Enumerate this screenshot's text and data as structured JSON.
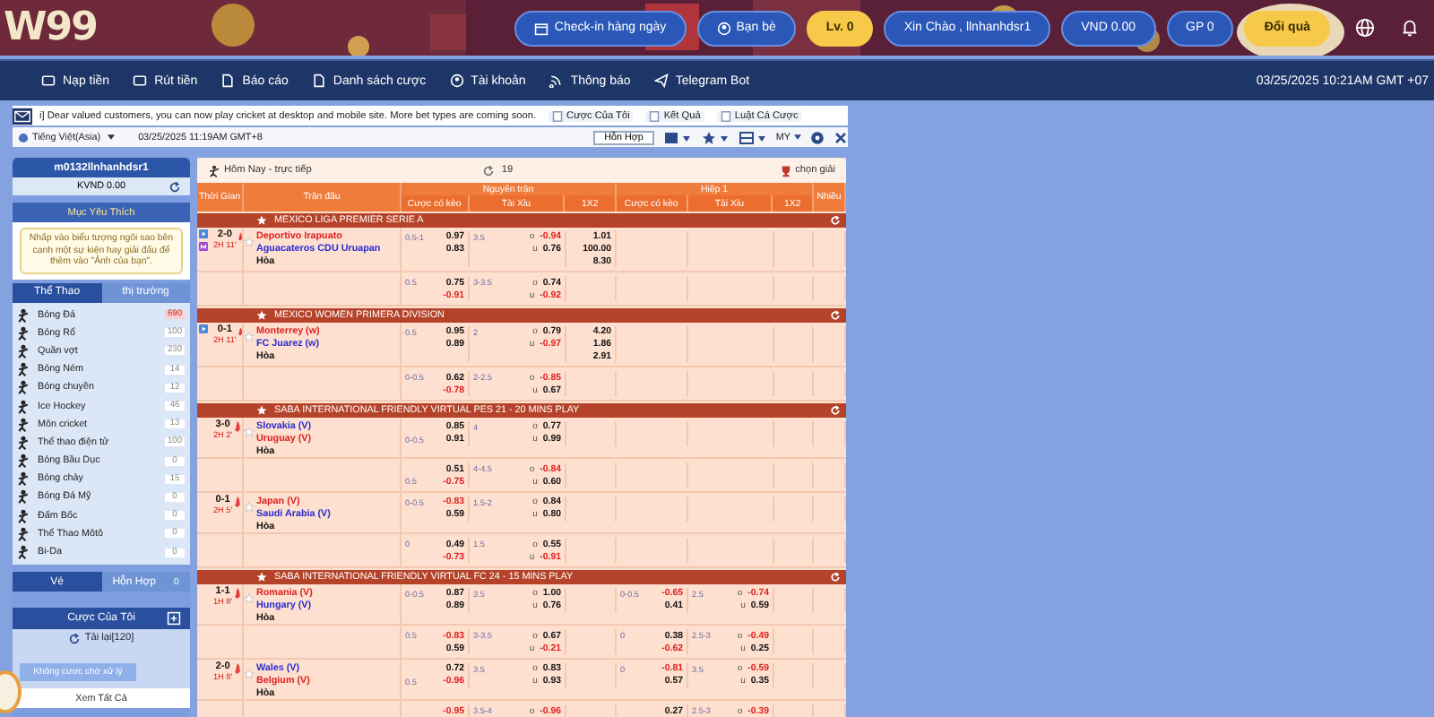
{
  "header": {
    "logo": "W99",
    "buttons": [
      {
        "label": "Check-in hàng ngày",
        "kind": "blue"
      },
      {
        "label": "Bạn bè",
        "kind": "blue"
      },
      {
        "label": "Lv. 0",
        "kind": "gold"
      },
      {
        "label": "Xin Chào , llnhanhdsr1",
        "kind": "blue"
      },
      {
        "label": "VND 0.00",
        "kind": "blue"
      },
      {
        "label": "GP 0",
        "kind": "blue"
      },
      {
        "label": "Đổi quà",
        "kind": "gold"
      }
    ]
  },
  "nav": {
    "items": [
      "Nạp tiền",
      "Rút tiền",
      "Báo cáo",
      "Danh sách cược",
      "Tài khoản",
      "Thông báo",
      "Telegram Bot"
    ],
    "datetime": "03/25/2025 10:21AM GMT +07"
  },
  "ticker": {
    "message": "i] Dear valued customers, you can now play cricket at desktop and mobile site. More bet types are coming soon.",
    "links": [
      "Cược Của Tôi",
      "Kết Quả",
      "Luật Cá Cược"
    ]
  },
  "toolbar": {
    "language": "Tiếng Việt(Asia)",
    "datetime": "03/25/2025 11:19AM GMT+8",
    "mode_button": "Hỗn Hợp",
    "odds_type": "MY"
  },
  "sidebar": {
    "username": "m0132llnhanhdsr1",
    "balance": "KVND 0.00",
    "favorites_title": "Mục Yêu Thích",
    "favorites_hint": "Nhấp vào biểu tượng ngôi sao bên cạnh một sự kiện hay giải đấu để thêm vào \"Ảnh của bạn\".",
    "tabs": [
      {
        "label": "Thể Thao",
        "selected": true
      },
      {
        "label": "thị trường",
        "selected": false
      }
    ],
    "sports": [
      {
        "name": "Bóng Đá",
        "count": "690",
        "hot": true
      },
      {
        "name": "Bóng Rổ",
        "count": "100",
        "hot": false
      },
      {
        "name": "Quần vợt",
        "count": "230",
        "hot": false
      },
      {
        "name": "Bóng Ném",
        "count": "14",
        "hot": false
      },
      {
        "name": "Bóng chuyền",
        "count": "12",
        "hot": false
      },
      {
        "name": "Ice Hockey",
        "count": "46",
        "hot": false
      },
      {
        "name": "Môn cricket",
        "count": "13",
        "hot": false
      },
      {
        "name": "Thể thao điện tử",
        "count": "100",
        "hot": false
      },
      {
        "name": "Bóng Bầu Dục",
        "count": "0",
        "hot": false
      },
      {
        "name": "Bóng chày",
        "count": "15",
        "hot": false
      },
      {
        "name": "Bóng Đá Mỹ",
        "count": "0",
        "hot": false
      },
      {
        "name": "Đấm Bốc",
        "count": "0",
        "hot": false
      },
      {
        "name": "Thể Thao Môtô",
        "count": "0",
        "hot": false
      },
      {
        "name": "Bi-Da",
        "count": "0",
        "hot": false
      }
    ],
    "slip_tabs": [
      {
        "label": "Vé",
        "selected": true
      },
      {
        "label": "Hỗn Hợp",
        "selected": false,
        "badge": "0"
      }
    ],
    "my_bets": {
      "title": "Cược Của Tôi",
      "reload": "Tải lại[120]",
      "pending_button": "Không cược chờ xử lý",
      "view_all": "Xem Tất Cả"
    }
  },
  "table": {
    "title": "Hôm Nay - trực tiếp",
    "count": "19",
    "filter": "chọn giải",
    "col_time": "Thời Gian",
    "col_match": "Trận đấu",
    "groups": [
      {
        "label": "Nguyên trận",
        "columns": [
          "Cược có kèo",
          "Tài Xỉu",
          "1X2"
        ]
      },
      {
        "label": "Hiệp 1",
        "columns": [
          "Cược có kèo",
          "Tài Xỉu",
          "1X2"
        ]
      }
    ],
    "col_more": "Nhiều",
    "leagues": [
      {
        "name": "MEXICO LIGA PREMIER SERIE A",
        "matches": [
          {
            "score": "2-0",
            "period": "2H 11'",
            "has_stream": true,
            "has_stats": true,
            "teams": [
              {
                "name": "Deportivo Irapuato",
                "favorite": true
              },
              {
                "name": "Aguacateros CDU Uruapan",
                "favorite": false
              }
            ],
            "draw": "Hòa",
            "lines": [
              [
                {
                  "hdp": "0.5-1",
                  "hdp_odds": "0.97",
                  "ou": "3.5",
                  "ou_side": "o",
                  "ou_odds": "-0.94",
                  "x12": "1.01"
                },
                {
                  "hdp_odds": "0.83",
                  "ou_side": "u",
                  "ou_odds": "0.76",
                  "x12": "100.00"
                },
                {
                  "x12": "8.30"
                }
              ],
              [
                {
                  "hdp": "0.5",
                  "hdp_odds": "0.75",
                  "ou": "3-3.5",
                  "ou_side": "o",
                  "ou_odds": "0.74"
                },
                {
                  "hdp_odds": "-0.91",
                  "ou_side": "u",
                  "ou_odds": "-0.92"
                }
              ]
            ]
          }
        ]
      },
      {
        "name": "MEXICO WOMEN PRIMERA DIVISION",
        "matches": [
          {
            "score": "0-1",
            "period": "2H 11'",
            "has_stream": true,
            "has_stats": false,
            "teams": [
              {
                "name": "Monterrey (w)",
                "favorite": true
              },
              {
                "name": "FC Juarez (w)",
                "favorite": false
              }
            ],
            "draw": "Hòa",
            "lines": [
              [
                {
                  "hdp": "0.5",
                  "hdp_odds": "0.95",
                  "ou": "2",
                  "ou_side": "o",
                  "ou_odds": "0.79",
                  "x12": "4.20"
                },
                {
                  "hdp_odds": "0.89",
                  "ou_side": "u",
                  "ou_odds": "-0.97",
                  "x12": "1.86"
                },
                {
                  "x12": "2.91"
                }
              ],
              [
                {
                  "hdp": "0-0.5",
                  "hdp_odds": "0.62",
                  "ou": "2-2.5",
                  "ou_side": "o",
                  "ou_odds": "-0.85"
                },
                {
                  "hdp_odds": "-0.78",
                  "ou_side": "u",
                  "ou_odds": "0.67"
                }
              ]
            ]
          }
        ]
      },
      {
        "name": "SABA INTERNATIONAL FRIENDLY VIRTUAL PES 21 - 20 MINS PLAY",
        "matches": [
          {
            "score": "3-0",
            "period": "2H 2'",
            "has_stream": false,
            "has_stats": false,
            "teams": [
              {
                "name": "Slovakia (V)",
                "favorite": false
              },
              {
                "name": "Uruguay (V)",
                "favorite": true
              }
            ],
            "draw": "Hòa",
            "lines": [
              [
                {
                  "hdp_odds": "0.85",
                  "ou": "4",
                  "ou_side": "o",
                  "ou_odds": "0.77"
                },
                {
                  "hdp": "0-0.5",
                  "hdp_odds": "0.91",
                  "ou_side": "u",
                  "ou_odds": "0.99"
                }
              ],
              [
                {
                  "hdp_odds": "0.51",
                  "ou": "4-4.5",
                  "ou_side": "o",
                  "ou_odds": "-0.84"
                },
                {
                  "hdp": "0.5",
                  "hdp_odds": "-0.75",
                  "ou_side": "u",
                  "ou_odds": "0.60"
                }
              ]
            ]
          },
          {
            "score": "0-1",
            "period": "2H 5'",
            "has_stream": false,
            "has_stats": false,
            "teams": [
              {
                "name": "Japan (V)",
                "favorite": true
              },
              {
                "name": "Saudi Arabia (V)",
                "favorite": false
              }
            ],
            "draw": "Hòa",
            "lines": [
              [
                {
                  "hdp": "0-0.5",
                  "hdp_odds": "-0.83",
                  "ou": "1.5-2",
                  "ou_side": "o",
                  "ou_odds": "0.84"
                },
                {
                  "hdp_odds": "0.59",
                  "ou_side": "u",
                  "ou_odds": "0.80"
                }
              ],
              [
                {
                  "hdp": "0",
                  "hdp_odds": "0.49",
                  "ou": "1.5",
                  "ou_side": "o",
                  "ou_odds": "0.55"
                },
                {
                  "hdp_odds": "-0.73",
                  "ou_side": "u",
                  "ou_odds": "-0.91"
                }
              ]
            ]
          }
        ]
      },
      {
        "name": "SABA INTERNATIONAL FRIENDLY VIRTUAL FC 24 - 15 MINS PLAY",
        "matches": [
          {
            "score": "1-1",
            "period": "1H 8'",
            "has_stream": false,
            "has_stats": false,
            "teams": [
              {
                "name": "Romania (V)",
                "favorite": true
              },
              {
                "name": "Hungary (V)",
                "favorite": false
              }
            ],
            "draw": "Hòa",
            "lines": [
              [
                {
                  "hdp": "0-0.5",
                  "hdp_odds": "0.87",
                  "ou": "3.5",
                  "ou_side": "o",
                  "ou_odds": "1.00",
                  "h1_hdp": "0-0.5",
                  "h1_hdp_odds": "-0.65",
                  "h1_ou": "2.5",
                  "h1_ou_side": "o",
                  "h1_ou_odds": "-0.74"
                },
                {
                  "hdp_odds": "0.89",
                  "ou_side": "u",
                  "ou_odds": "0.76",
                  "h1_hdp_odds": "0.41",
                  "h1_ou_side": "u",
                  "h1_ou_odds": "0.59"
                }
              ],
              [
                {
                  "hdp": "0.5",
                  "hdp_odds": "-0.83",
                  "ou": "3-3.5",
                  "ou_side": "o",
                  "ou_odds": "0.67",
                  "h1_hdp": "0",
                  "h1_hdp_odds": "0.38",
                  "h1_ou": "2.5-3",
                  "h1_ou_side": "o",
                  "h1_ou_odds": "-0.49"
                },
                {
                  "hdp_odds": "0.59",
                  "ou_side": "u",
                  "ou_odds": "-0.21",
                  "h1_hdp_odds": "-0.62",
                  "h1_ou_side": "u",
                  "h1_ou_odds": "0.25"
                }
              ]
            ]
          },
          {
            "score": "2-0",
            "period": "1H 8'",
            "has_stream": false,
            "has_stats": false,
            "teams": [
              {
                "name": "Wales (V)",
                "favorite": false
              },
              {
                "name": "Belgium (V)",
                "favorite": true
              }
            ],
            "draw": "Hòa",
            "lines": [
              [
                {
                  "hdp_odds": "0.72",
                  "ou": "3.5",
                  "ou_side": "o",
                  "ou_odds": "0.83",
                  "h1_hdp": "0",
                  "h1_hdp_odds": "-0.81",
                  "h1_ou": "3.5",
                  "h1_ou_side": "o",
                  "h1_ou_odds": "-0.59"
                },
                {
                  "hdp": "0.5",
                  "hdp_odds": "-0.96",
                  "ou_side": "u",
                  "ou_odds": "0.93",
                  "h1_hdp_odds": "0.57",
                  "h1_ou_side": "u",
                  "h1_ou_odds": "0.35"
                }
              ],
              [
                {
                  "hdp_odds": "-0.95",
                  "ou": "3.5-4",
                  "ou_side": "o",
                  "ou_odds": "-0.96",
                  "h1_hdp_odds": "0.27",
                  "h1_ou": "2.5-3",
                  "h1_ou_side": "o",
                  "h1_ou_odds": "-0.39"
                }
              ]
            ]
          }
        ]
      }
    ]
  }
}
